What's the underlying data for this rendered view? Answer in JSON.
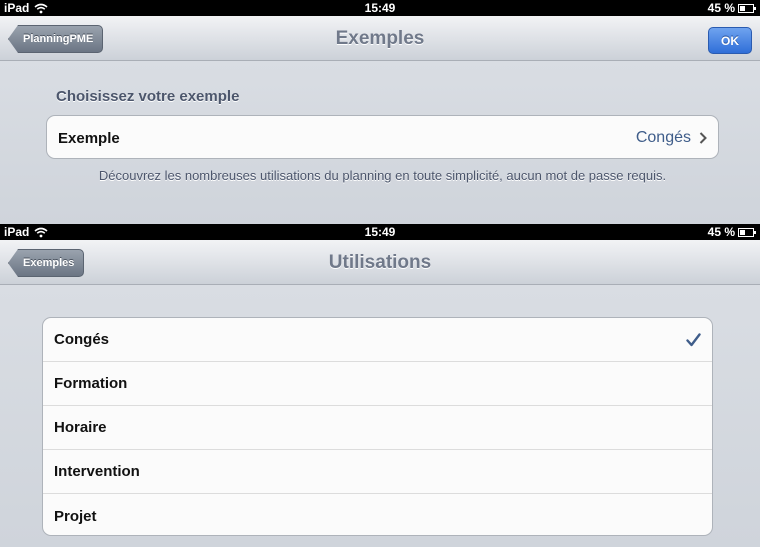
{
  "screen1": {
    "status": {
      "carrier": "iPad",
      "time": "15:49",
      "battery": "45 %",
      "battery_level": 0.45
    },
    "nav": {
      "back_label": "PlanningPME",
      "title": "Exemples",
      "ok_label": "OK"
    },
    "section_header": "Choisissez votre exemple",
    "cell": {
      "label": "Exemple",
      "value": "Congés"
    },
    "footer": "Découvrez les nombreuses utilisations du planning en toute simplicité, aucun mot de passe requis."
  },
  "screen2": {
    "status": {
      "carrier": "iPad",
      "time": "15:49",
      "battery": "45 %",
      "battery_level": 0.45
    },
    "nav": {
      "back_label": "Exemples",
      "title": "Utilisations"
    },
    "items": [
      {
        "label": "Congés",
        "selected": true
      },
      {
        "label": "Formation",
        "selected": false
      },
      {
        "label": "Horaire",
        "selected": false
      },
      {
        "label": "Intervention",
        "selected": false
      },
      {
        "label": "Projet",
        "selected": false
      }
    ]
  },
  "colors": {
    "accent": "#3f5d8a",
    "ok_button": "#2f6ed8",
    "nav_title": "#70798a"
  },
  "icons": [
    "wifi-icon",
    "battery-icon",
    "chevron-right-icon",
    "checkmark-icon"
  ]
}
